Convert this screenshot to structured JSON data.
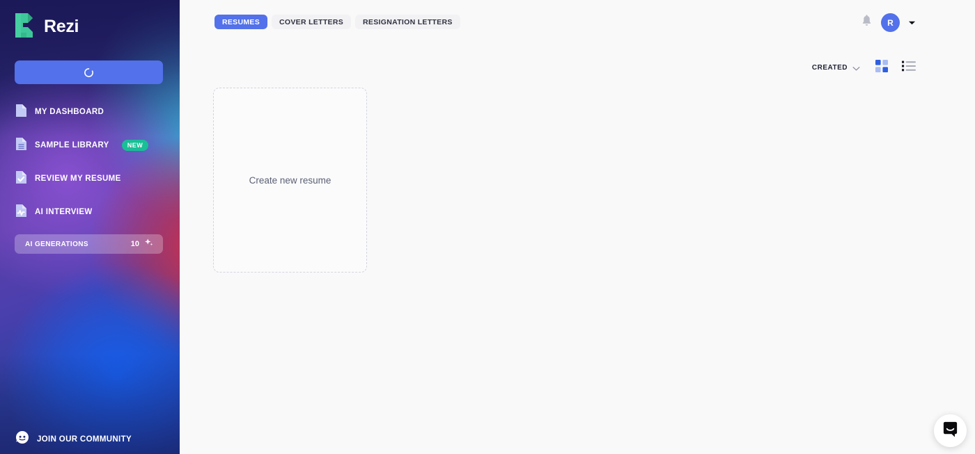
{
  "brand": {
    "name": "Rezi",
    "logo_icon": "rezi-r-logo-icon",
    "logo_color": "#3ec79a"
  },
  "sidebar": {
    "new_button": {
      "label": "",
      "state": "loading",
      "icon": "loading-spinner-icon",
      "color": "#5271ea"
    },
    "items": [
      {
        "label": "MY DASHBOARD",
        "icon": "document-icon",
        "badge": ""
      },
      {
        "label": "SAMPLE LIBRARY",
        "icon": "document-lines-icon",
        "badge": "NEW"
      },
      {
        "label": "REVIEW MY RESUME",
        "icon": "document-check-icon",
        "badge": ""
      },
      {
        "label": "AI INTERVIEW",
        "icon": "document-waveform-icon",
        "badge": ""
      }
    ],
    "badge_color": "#19bf96",
    "generations": {
      "label": "AI GENERATIONS",
      "count": "10",
      "icon": "sparkle-icon"
    },
    "community": {
      "label": "JOIN OUR COMMUNITY",
      "icon": "reddit-icon"
    }
  },
  "header": {
    "tabs": [
      {
        "label": "RESUMES",
        "active": true
      },
      {
        "label": "COVER LETTERS",
        "active": false
      },
      {
        "label": "RESIGNATION LETTERS",
        "active": false
      }
    ],
    "notifications_icon": "bell-icon",
    "avatar": {
      "initial": "R",
      "color": "#5271ea"
    },
    "account_caret_icon": "chevron-down-icon"
  },
  "toolbar": {
    "sort_label": "CREATED",
    "sort_caret_icon": "chevron-down-icon",
    "grid_view_icon": "grid-view-icon",
    "list_view_icon": "list-view-icon",
    "active_view": "grid"
  },
  "main": {
    "create_card": {
      "label": "Create new resume",
      "icon": "dashed-placeholder-card"
    }
  },
  "chat": {
    "launcher_icon": "chat-bubble-icon"
  }
}
